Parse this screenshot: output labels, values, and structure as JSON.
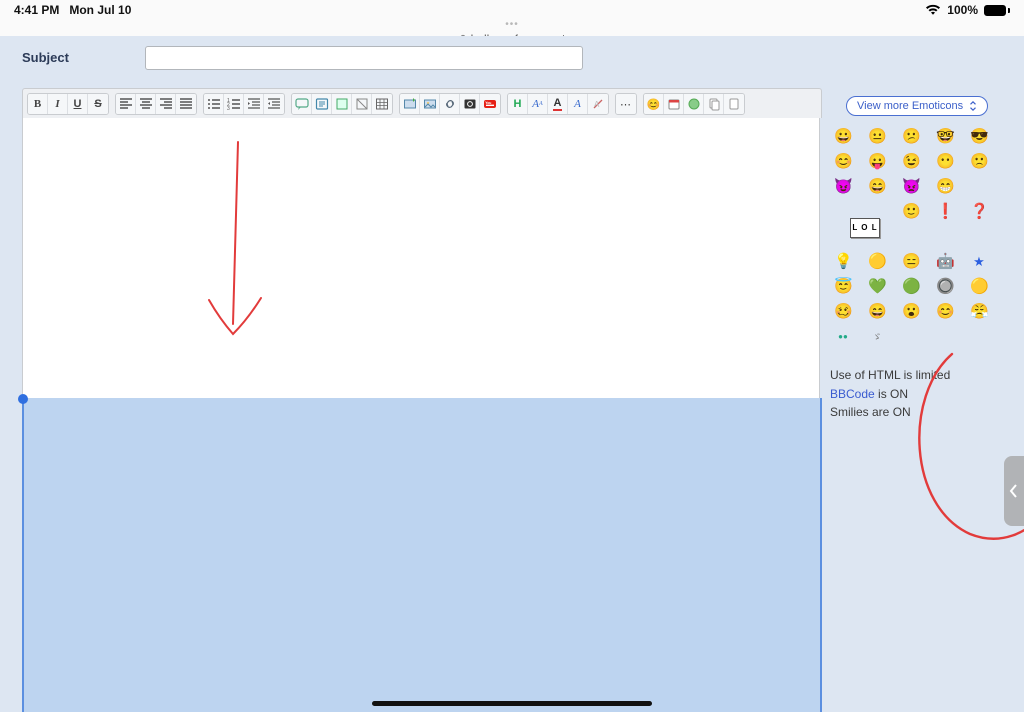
{
  "status": {
    "time": "4:41 PM",
    "date": "Mon Jul 10",
    "battery_pct": "100%"
  },
  "browser": {
    "url_host": "bullseyeforum.net"
  },
  "form": {
    "subject_label": "Subject",
    "subject_value": ""
  },
  "toolbar": {
    "groups": [
      [
        "bold",
        "italic",
        "underline",
        "strike"
      ],
      [
        "align-left",
        "align-center",
        "align-right",
        "align-justify"
      ],
      [
        "list-ul",
        "list-ol",
        "list-indent",
        "list-outdent"
      ],
      [
        "quote",
        "code",
        "spoiler",
        "hidden",
        "table"
      ],
      [
        "image-host",
        "image",
        "link",
        "link-page",
        "youtube"
      ],
      [
        "h",
        "font-size",
        "font-color",
        "font-name",
        "remove-format"
      ],
      [
        "more"
      ],
      [
        "emoji",
        "date",
        "link-user",
        "copy",
        "paste"
      ]
    ]
  },
  "emoticons": {
    "view_more_label": "View more Emoticons",
    "grid": [
      "😀",
      "😐",
      "😕",
      "🤓",
      "😎",
      "😊",
      "😛",
      "😉",
      "😶",
      "🙁",
      "😈",
      "😄",
      "👿",
      "😁",
      "",
      "lol",
      "lol",
      "😊",
      "❗",
      "❓",
      "lol",
      "lol",
      "",
      "",
      "",
      "💡",
      "🟡",
      "😑",
      "🤖",
      "★",
      "😇",
      "💚",
      "🟢",
      "🔘",
      "🟡",
      "🥴",
      "😄",
      "😮",
      "😊",
      "😤",
      "oo",
      "ba",
      "",
      "",
      ""
    ]
  },
  "status_text": {
    "line1_pre": "Use of HTML is ",
    "line1_val": "limited",
    "bbcode_label": "BBCode",
    "line2_suffix": " is ON",
    "line3_pre": "Smilies are ",
    "line3_val": "ON"
  }
}
